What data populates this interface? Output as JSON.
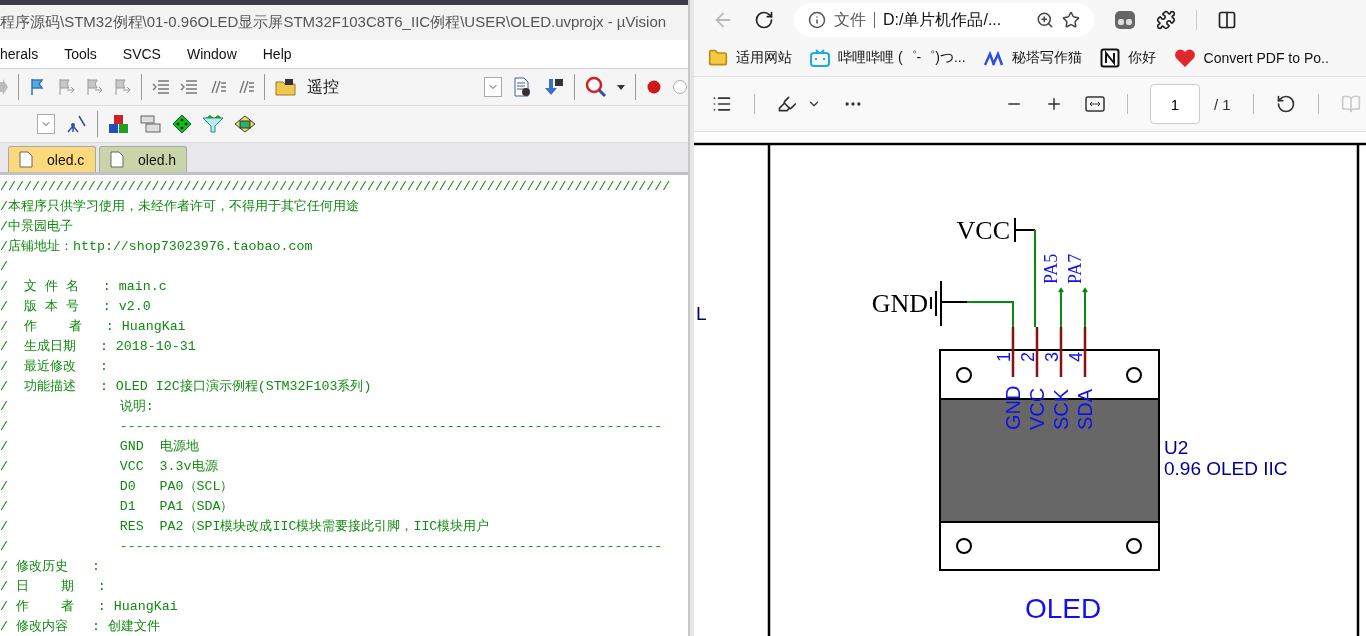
{
  "ide": {
    "title": "程序源码\\STM32例程\\01-0.96OLED显示屏STM32F103C8T6_IIC例程\\USER\\OLED.uvprojx - µVision",
    "menu": [
      "herals",
      "Tools",
      "SVCS",
      "Window",
      "Help"
    ],
    "find_text": "遥控",
    "tabs": [
      {
        "label": "oled.c",
        "selected": true
      },
      {
        "label": "oled.h",
        "selected": false
      }
    ],
    "code_lines": [
      "////////////////////////////////////////////////////////////////////////////////////",
      "/本程序只供学习使用，未经作者许可，不得用于其它任何用途",
      "/中景园电子",
      "/店铺地址：http://shop73023976.taobao.com",
      "/",
      "/  文 件 名   : main.c",
      "/  版 本 号   : v2.0",
      "/  作    者   : HuangKai",
      "/  生成日期   : 2018-10-31",
      "/  最近修改   :",
      "/  功能描述   : OLED I2C接口演示例程(STM32F103系列)",
      "/              说明:",
      "/              --------------------------------------------------------------------",
      "/              GND  电源地",
      "/              VCC  3.3v电源",
      "/              D0   PA0（SCL）",
      "/              D1   PA1（SDA）",
      "/              RES  PA2（SPI模块改成IIC模块需要接此引脚，IIC模块用户",
      "/              --------------------------------------------------------------------",
      "/ 修改历史   :",
      "/ 日    期   :",
      "/ 作    者   : HuangKai",
      "/ 修改内容   : 创建文件"
    ]
  },
  "browser": {
    "address": {
      "scheme": "文件",
      "url": "D:/单片机作品/..."
    },
    "bookmarks": [
      {
        "kind": "folder",
        "label": "适用网站"
      },
      {
        "kind": "tv",
        "label": "哔哩哔哩 (゜-゜)つ..."
      },
      {
        "kind": "chevrons",
        "label": "秘塔写作猫"
      },
      {
        "kind": "notion",
        "label": "你好"
      },
      {
        "kind": "heart",
        "label": "Convert PDF to Po.."
      }
    ],
    "pdf_toolbar": {
      "page": "1",
      "total": "/ 1"
    },
    "schematic": {
      "edge_label": "L",
      "vcc": "VCC",
      "gnd": "GND",
      "net_labels": [
        "PA5",
        "PA7"
      ],
      "pins": [
        {
          "number": "1",
          "name": "GND"
        },
        {
          "number": "2",
          "name": "VCC"
        },
        {
          "number": "3",
          "name": "SCK"
        },
        {
          "number": "4",
          "name": "SDA"
        }
      ],
      "designator": "U2",
      "value": "0.96 OLED IIC",
      "title": "OLED"
    }
  }
}
